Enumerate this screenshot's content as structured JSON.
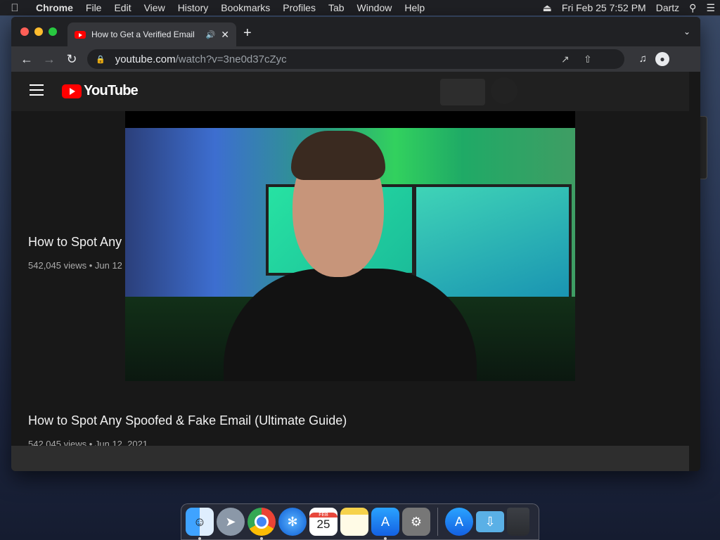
{
  "menubar": {
    "apple_icon": "apple-icon",
    "app_name": "Chrome",
    "items": [
      "File",
      "Edit",
      "View",
      "History",
      "Bookmarks",
      "Profiles",
      "Tab",
      "Window",
      "Help"
    ],
    "datetime": "Fri Feb 25  7:52 PM",
    "user": "Dartz"
  },
  "browser": {
    "tab_title": "How to Get a Verified Email",
    "url_host": "youtube.com",
    "url_path": "/watch?v=3ne0d37cZyc"
  },
  "youtube": {
    "logo_text": "YouTube",
    "behind_video": {
      "title": "How to Spot Any",
      "meta": "542,045 views • Jun 12"
    },
    "main_video": {
      "title": "How to Spot Any Spoofed & Fake Email (Ultimate Guide)",
      "meta": "542,045 views • Jun 12, 2021"
    }
  },
  "dock": {
    "calendar_month": "FEB",
    "calendar_day": "25",
    "apps": [
      "Finder",
      "Launchpad",
      "Google Chrome",
      "Safari",
      "Calendar",
      "Notes",
      "App Store",
      "System Preferences",
      "App Store",
      "Downloads",
      "Trash"
    ]
  },
  "colors": {
    "youtube_red": "#ff0000",
    "browser_dark": "#202124",
    "toolbar": "#35363a"
  }
}
